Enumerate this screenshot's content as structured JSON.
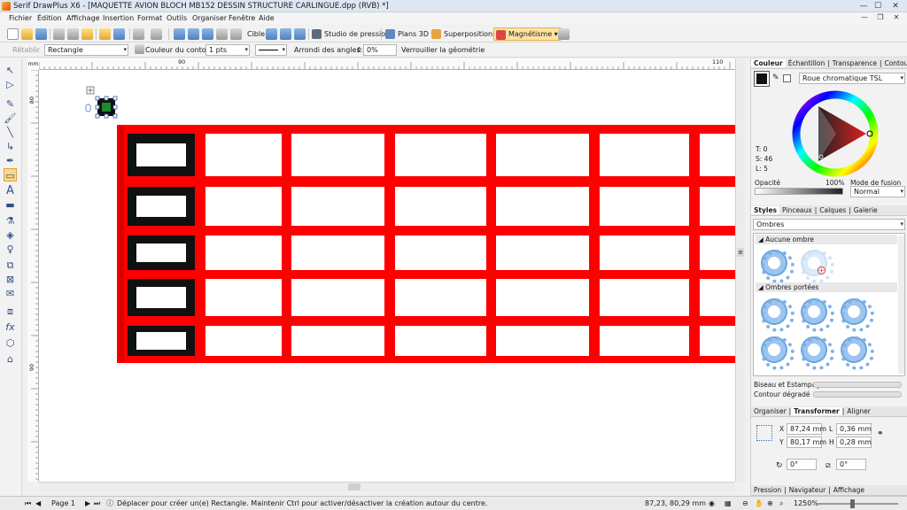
{
  "window": {
    "title": "Serif DrawPlus X6 - [MAQUETTE AVION BLOCH MB152 DESSIN STRUCTURE CARLINGUE.dpp (RVB) *]",
    "min": "—",
    "max": "☐",
    "close": "✕"
  },
  "menu": [
    "Fichier",
    "Édition",
    "Affichage",
    "Insertion",
    "Format",
    "Outils",
    "Organiser",
    "Fenêtre",
    "Aide"
  ],
  "toolbar1": {
    "cible": "Cible",
    "studio": "Studio de pression",
    "plans3d": "Plans 3D",
    "superpositions": "Superpositions",
    "magnetisme": "Magnétisme"
  },
  "toolbar2": {
    "retablir": "Rétablir",
    "shape": "Rectangle",
    "couleur_contour": "Couleur du contour",
    "contour_width": "1 pts",
    "arrondi": "Arrondi des angles:",
    "arrondi_value": "0%",
    "verrouiller": "Verrouiller la géométrie"
  },
  "ruler": {
    "unit": "mm",
    "h_labels": [
      "90",
      "110"
    ],
    "v_labels": [
      "80",
      "90"
    ]
  },
  "colour_panel": {
    "tabs": [
      "Couleur",
      "Échantillon",
      "Transparence",
      "Contour"
    ],
    "mode": "Roue chromatique TSL",
    "t": "T: 0",
    "s": "S: 46",
    "l": "L: 5",
    "opacite_label": "Opacité",
    "opacite_value": "100%",
    "fusion_label": "Mode de fusion",
    "fusion_value": "Normal"
  },
  "styles_panel": {
    "tabs": [
      "Styles",
      "Pinceaux",
      "Calques",
      "Galerie"
    ],
    "category": "Ombres",
    "section1": "Aucune ombre",
    "section2": "Ombres portées",
    "biseau": "Biseau et Estampage",
    "contour_degrade": "Contour dégradé"
  },
  "transform_panel": {
    "tabs": [
      "Organiser",
      "Transformer",
      "Aligner"
    ],
    "x_label": "X",
    "x": "87,24 mm",
    "y_label": "Y",
    "y": "80,17 mm",
    "l_label": "L",
    "l": "0,36 mm",
    "h_label": "H",
    "h": "0,28 mm",
    "rot": "0°",
    "skew": "0°"
  },
  "bottom_tabs": [
    "Pression",
    "Navigateur",
    "Affichage"
  ],
  "status": {
    "page": "Page 1",
    "hint": "Déplacer pour créer un(e) Rectangle. Maintenir Ctrl pour activer/désactiver la création autour du centre.",
    "coords": "87,23, 80,29 mm",
    "zoom": "1250%"
  },
  "drawing": {
    "frame_color": "#ff0000",
    "dark_color": "#111111",
    "rows": 5,
    "visible_columns": 7,
    "zoom_percent": 1250
  }
}
